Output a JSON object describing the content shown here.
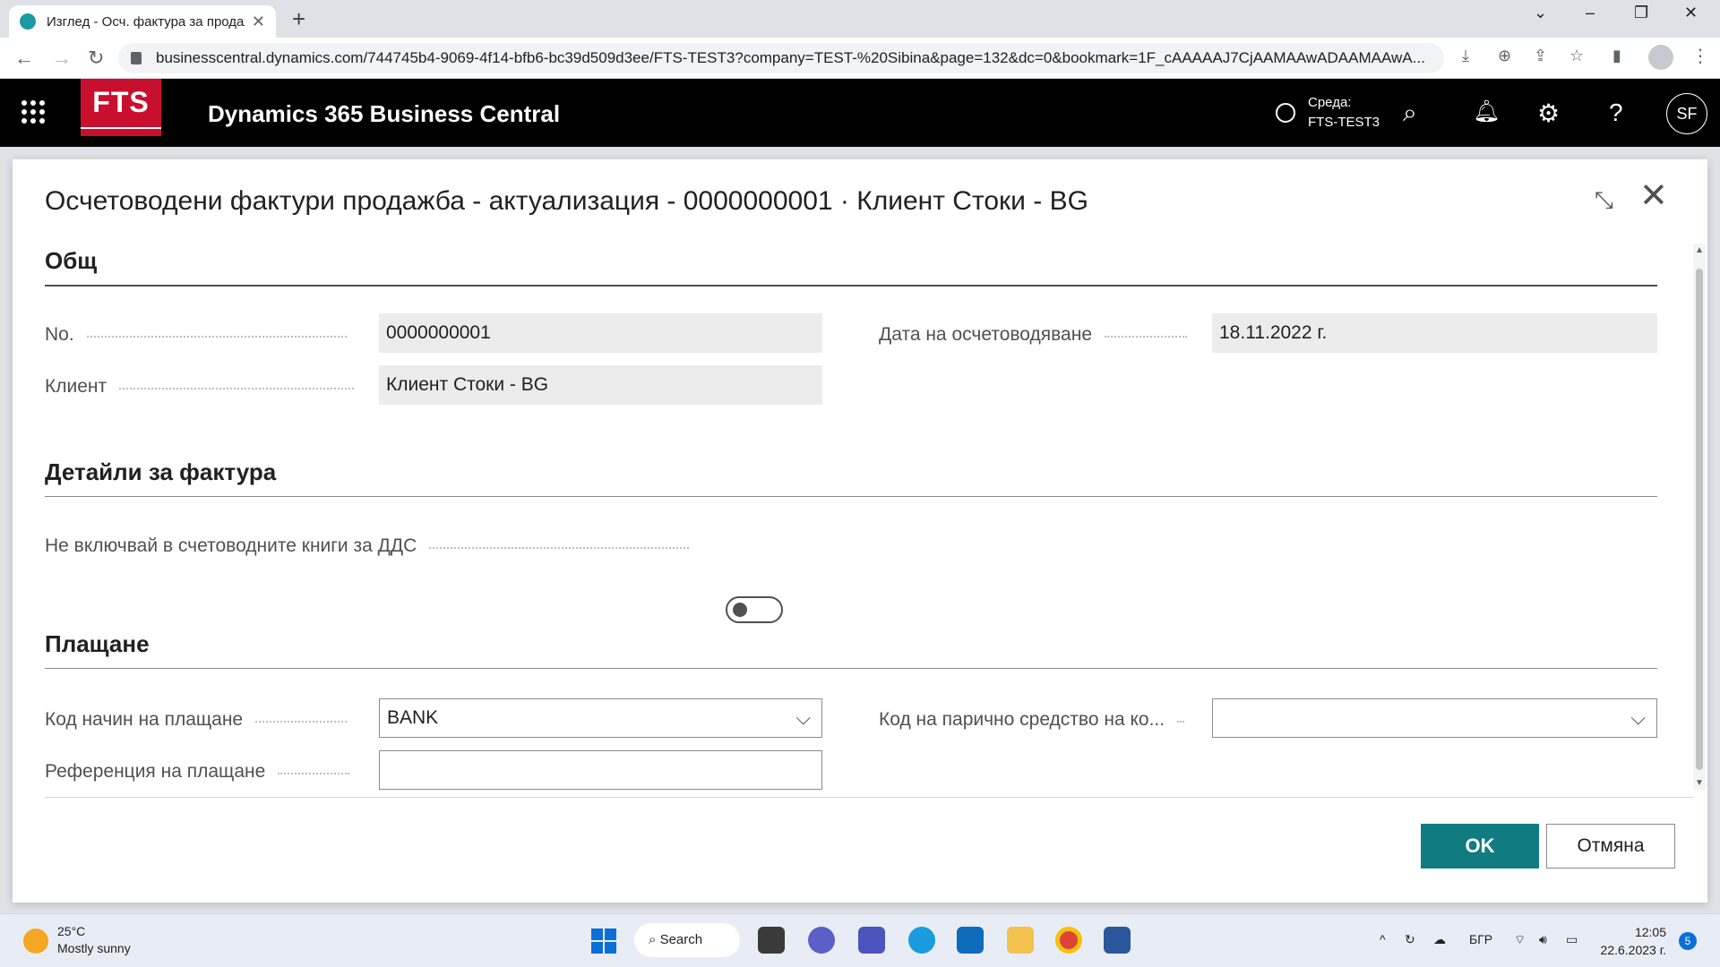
{
  "browser": {
    "tab_title": "Изглед - Осч. фактура за продажба",
    "url": "businesscentral.dynamics.com/744745b4-9069-4f14-bfb6-bc39d509d3ee/FTS-TEST3?company=TEST-%20Sibina&page=132&dc=0&bookmark=1F_cAAAAAJ7CjAAMAAwADAAMAAwA..."
  },
  "app": {
    "logo": "FTS",
    "title": "Dynamics 365 Business Central",
    "env_label": "Среда:",
    "env_name": "FTS-TEST3",
    "user_initials": "SF"
  },
  "dialog": {
    "title": "Осчетоводени фактури продажба - актуализация - 0000000001 · Клиент Стоки - BG",
    "sections": {
      "general": {
        "title": "Общ",
        "no_label": "No.",
        "no_value": "0000000001",
        "customer_label": "Клиент",
        "customer_value": "Клиент Стоки - BG",
        "posting_date_label": "Дата на осчетоводяване",
        "posting_date_value": "18.11.2022 г."
      },
      "invoice_details": {
        "title": "Детайли за фактура",
        "exclude_vat_label": "Не включвай в счетоводните книги за ДДС",
        "exclude_vat_on": false
      },
      "payment": {
        "title": "Плащане",
        "method_label": "Код начин на плащане",
        "method_value": "BANK",
        "cash_code_label": "Код на парично средство на ко...",
        "cash_code_value": "",
        "reference_label": "Референция на плащане",
        "reference_value": ""
      }
    },
    "ok_label": "OK",
    "cancel_label": "Отмяна"
  },
  "taskbar": {
    "temperature": "25°C",
    "weather": "Mostly sunny",
    "search_label": "Search",
    "language": "БГР",
    "time": "12:05",
    "date": "22.6.2023 г.",
    "notifications": "5"
  }
}
